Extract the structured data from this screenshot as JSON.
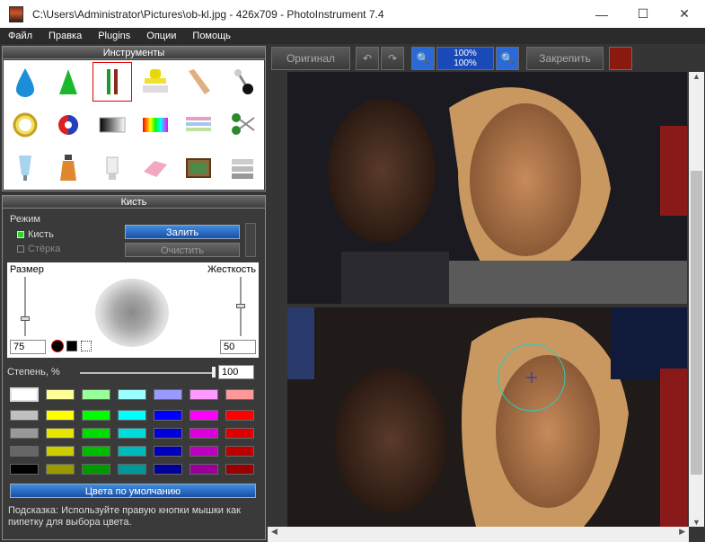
{
  "window": {
    "title": "C:\\Users\\Administrator\\Pictures\\ob-kl.jpg - 426x709 - PhotoInstrument 7.4",
    "minimize": "—",
    "maximize": "☐",
    "close": "✕"
  },
  "menu": [
    "Файл",
    "Правка",
    "Plugins",
    "Опции",
    "Помощь"
  ],
  "tools_panel": {
    "title": "Инструменты",
    "tools": [
      "drop-icon",
      "cone-icon",
      "brush-pencil-icon",
      "stamp-icon",
      "finger-icon",
      "pin-icon",
      "clock-icon",
      "color-wheel-icon",
      "gradient-icon",
      "palette-icon",
      "stripes-icon",
      "scissors-icon",
      "tube-icon",
      "bottle-icon",
      "bulb-icon",
      "eraser-icon",
      "image-icon",
      "text-icon"
    ]
  },
  "brush_panel": {
    "title": "Кисть",
    "mode_label": "Режим",
    "brush_option": "Кисть",
    "eraser_option": "Стёрка",
    "fill_button": "Залить",
    "clear_button": "Очистить",
    "size_label": "Размер",
    "hardness_label": "Жесткость",
    "size_value": "75",
    "hardness_value": "50",
    "degree_label": "Степень, %",
    "degree_value": "100",
    "default_colors_button": "Цвета по умолчанию",
    "hint": "Подсказка: Используйте правую кнопки мышки как пипетку для выбора цвета."
  },
  "palette": {
    "rows": [
      [
        "#ffffff",
        "#ffff99",
        "#99ff99",
        "#99ffff",
        "#9999ff",
        "#ff99ff",
        "#ff9999"
      ],
      [
        "#c0c0c0",
        "#ffff00",
        "#00ff00",
        "#00ffff",
        "#0000ff",
        "#ff00ff",
        "#ff0000"
      ],
      [
        "#999999",
        "#e6e600",
        "#00dd00",
        "#00dddd",
        "#0000dd",
        "#dd00dd",
        "#dd0000"
      ],
      [
        "#666666",
        "#cccc00",
        "#00bb00",
        "#00bbbb",
        "#0000bb",
        "#bb00bb",
        "#bb0000"
      ],
      [
        "#000000",
        "#999900",
        "#009900",
        "#009999",
        "#000099",
        "#990099",
        "#990000"
      ]
    ]
  },
  "toolbar": {
    "original_button": "Оригинал",
    "zoom_top": "100%",
    "zoom_bottom": "100%",
    "pin_button": "Закрепить"
  },
  "colors": {
    "accent": "#1a5fc0",
    "selected_tool_border": "#dd0000"
  }
}
